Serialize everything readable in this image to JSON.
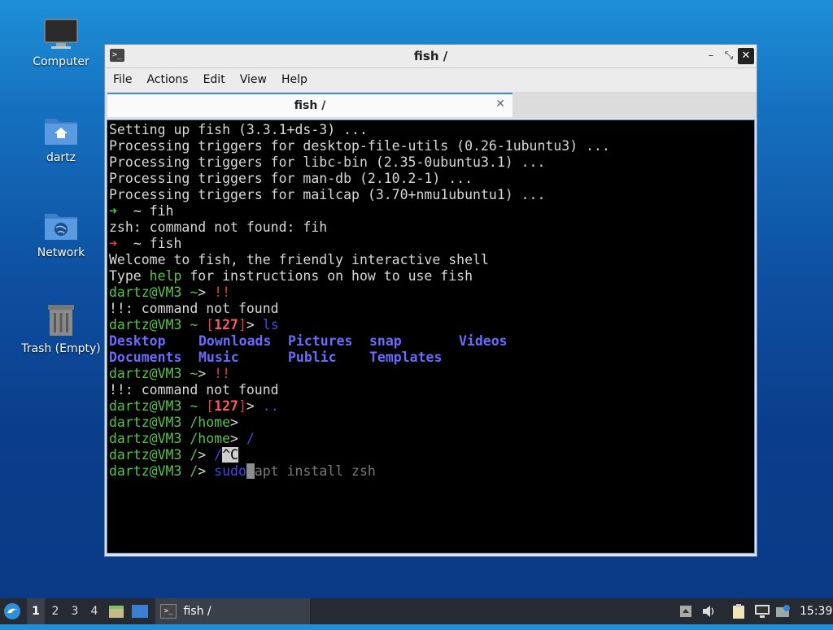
{
  "desktop": {
    "icons": [
      {
        "label": "Computer",
        "icon": "monitor-icon"
      },
      {
        "label": "dartz",
        "icon": "home-folder-icon"
      },
      {
        "label": "Network",
        "icon": "network-folder-icon"
      },
      {
        "label": "Trash (Empty)",
        "icon": "trash-icon"
      }
    ]
  },
  "window": {
    "title": "fish /",
    "controls": {
      "minimize": "–",
      "maximize": "⤡",
      "close": "✕"
    },
    "menu": [
      "File",
      "Actions",
      "Edit",
      "View",
      "Help"
    ],
    "tab": {
      "label": "fish /",
      "close": "✕"
    }
  },
  "terminal": {
    "l1": "Setting up fish (3.3.1+ds-3) ...",
    "l2": "Processing triggers for desktop-file-utils (0.26-1ubuntu3) ...",
    "l3": "Processing triggers for libc-bin (2.35-0ubuntu3.1) ...",
    "l4": "Processing triggers for man-db (2.10.2-1) ...",
    "l5": "Processing triggers for mailcap (3.70+nmu1ubuntu1) ...",
    "arrow": "➜",
    "tilde": "~",
    "cmd_fih": "fih",
    "zsh_err": "zsh: command not found: fih",
    "cmd_fish": "fish",
    "welcome": "Welcome to fish, the friendly interactive shell",
    "type": "Type ",
    "help": "help",
    "help_rest": " for instructions on how to use fish",
    "user": "dartz@VM3",
    "prompt_home": "~",
    "gt": ">",
    "bang": "!!",
    "bang_err": "!!: command not found",
    "status_open": "[",
    "status_code": "127",
    "status_close": "]",
    "cmd_ls": "ls",
    "ls": [
      [
        "Desktop",
        "Downloads",
        "Pictures",
        "snap",
        "Videos"
      ],
      [
        "Documents",
        "Music",
        "Public",
        "Templates",
        ""
      ]
    ],
    "cmd_up": "..",
    "cwd_home": "/home",
    "cmd_root": "/",
    "cwd_root": "/",
    "ctrl_c": "^C",
    "sudo": "sudo",
    "suggestion": "apt install zsh"
  },
  "taskbar": {
    "workspaces": [
      "1",
      "2",
      "3",
      "4"
    ],
    "task_label": "fish /",
    "clock": "15:39"
  }
}
